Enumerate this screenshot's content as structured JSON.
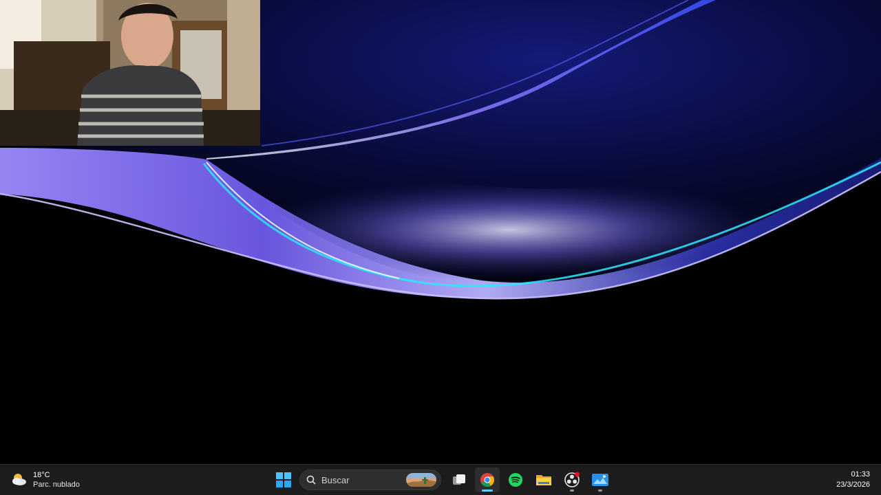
{
  "taskbar": {
    "weather": {
      "temperature": "18°C",
      "description": "Parc. nublado",
      "icon": "partly-cloudy-icon"
    },
    "search": {
      "placeholder": "Buscar"
    },
    "pinned_apps": [
      {
        "name": "start",
        "icon": "windows-logo-icon"
      },
      {
        "name": "task-view",
        "icon": "task-view-icon"
      },
      {
        "name": "chrome",
        "icon": "chrome-icon",
        "active": true
      },
      {
        "name": "spotify",
        "icon": "spotify-icon"
      },
      {
        "name": "file-explorer",
        "icon": "folder-icon"
      },
      {
        "name": "obs",
        "icon": "obs-icon",
        "badge": true
      },
      {
        "name": "photos",
        "icon": "photos-icon"
      }
    ],
    "clock": {
      "time": "01:33",
      "date": "23/3/2026"
    }
  },
  "colors": {
    "taskbar_bg": "#1c1c1c",
    "accent": "#60cdff",
    "wallpaper_purple": "#8a6cf0",
    "wallpaper_cyan": "#2ee6ff"
  }
}
